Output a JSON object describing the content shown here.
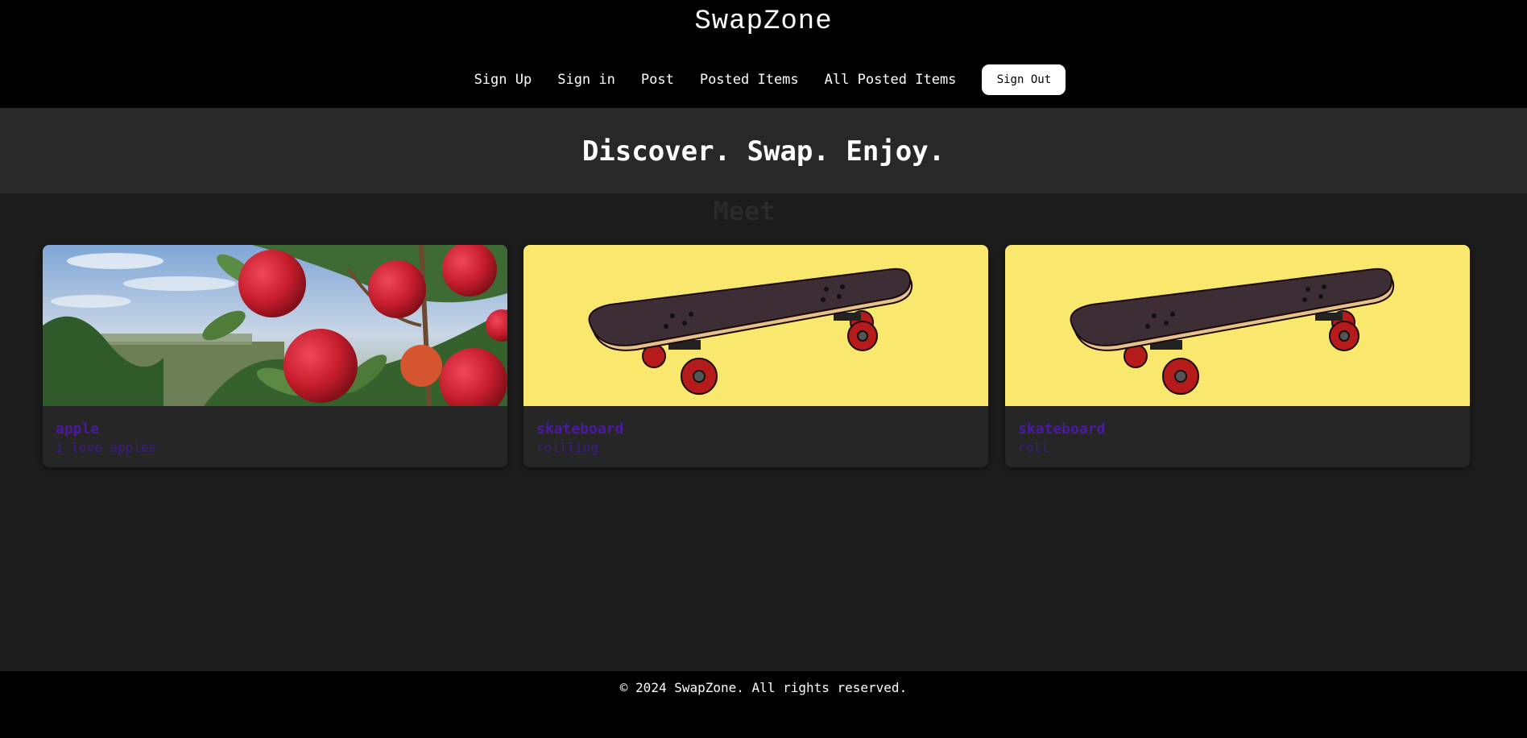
{
  "brand": "SwapZone",
  "nav": {
    "links": [
      "Sign Up",
      "Sign in",
      "Post",
      "Posted Items",
      "All Posted Items"
    ],
    "signout_label": "Sign Out"
  },
  "hero": {
    "title": "Discover. Swap. Enjoy."
  },
  "section": {
    "heading": "Meet"
  },
  "items": [
    {
      "title": "apple",
      "description": "i love apples",
      "image": "apple-tree-photo"
    },
    {
      "title": "skateboard",
      "description": "rollling",
      "image": "skateboard-illustration"
    },
    {
      "title": "skateboard",
      "description": "roll",
      "image": "skateboard-illustration"
    }
  ],
  "footer": {
    "copyright": "© 2024 SwapZone. All rights reserved."
  },
  "colors": {
    "header_bg": "#000000",
    "hero_bg": "#282828",
    "page_bg": "#1c1c1c",
    "card_bg": "#262626",
    "item_title": "#4b1aa0",
    "skate_bg": "#fae86e"
  }
}
